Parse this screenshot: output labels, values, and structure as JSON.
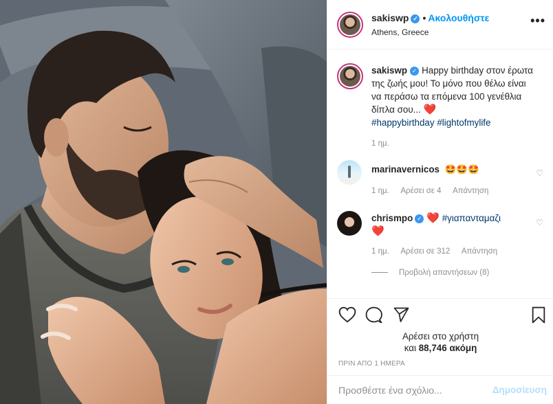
{
  "post": {
    "author": "sakiswp",
    "follow_label": "Ακολουθήστε",
    "location": "Athens, Greece",
    "more_label": "•••"
  },
  "caption": {
    "user": "sakiswp",
    "text": "Happy birthday στον έρωτα της ζωής μου! Το μόνο που θέλω είναι να περάσω τα επόμενα 100 γενέθλια δίπλα σου...",
    "heart": "❤️",
    "hashtag1": "#happybirthday",
    "hashtag2": "#lightofmylife",
    "time": "1 ημ."
  },
  "comments": [
    {
      "user": "marinavernicos",
      "text": "🤩🤩🤩",
      "time": "1 ημ.",
      "likes": "Αρέσει σε 4",
      "reply": "Απάντηση"
    },
    {
      "user": "chrismpo",
      "heart": "❤️",
      "hashtag": "#γιαπανταμαζι",
      "heart2": "❤️",
      "time": "1 ημ.",
      "likes": "Αρέσει σε 312",
      "reply": "Απάντηση"
    }
  ],
  "view_replies": "Προβολή απαντήσεων (8)",
  "liked_by": {
    "line1": "Αρέσει στο χρήστη",
    "line2_prefix": "και",
    "count": "88,746",
    "line2_suffix": "ακόμη"
  },
  "posted_ago": "ΠΡΙΝ ΑΠΟ 1 ΗΜΕΡΑ",
  "add_comment": {
    "placeholder": "Προσθέστε ένα σχόλιο...",
    "post_label": "Δημοσίευση"
  },
  "colors": {
    "accent": "#0095f6",
    "verified": "#3897f0",
    "heart": "#ed4956",
    "muted": "#8e8e8e"
  },
  "icons": [
    "heart-icon",
    "comment-icon",
    "share-icon",
    "bookmark-icon",
    "verified-icon",
    "more-icon"
  ]
}
